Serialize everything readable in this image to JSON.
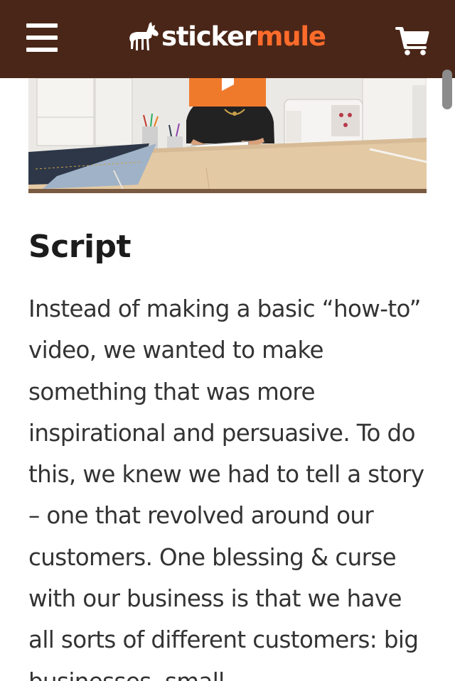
{
  "header": {
    "logo": {
      "part1": "sticker",
      "part2": "mule"
    },
    "menu_icon": "hamburger-menu-icon",
    "cart_icon": "shopping-cart-icon",
    "colors": {
      "background": "#4a2618",
      "logo_accent": "#ff6b2b"
    }
  },
  "video": {
    "play_icon": "play-icon",
    "play_color": "#f07a2c"
  },
  "article": {
    "heading": "Script",
    "paragraph": "Instead of making a basic “how-to” video, we wanted to make something that was more inspirational and persuasive. To do this, we knew we had to tell a story – one that revolved around our customers. One blessing & curse with our business is that we have all sorts of different customers: big businesses, small"
  }
}
